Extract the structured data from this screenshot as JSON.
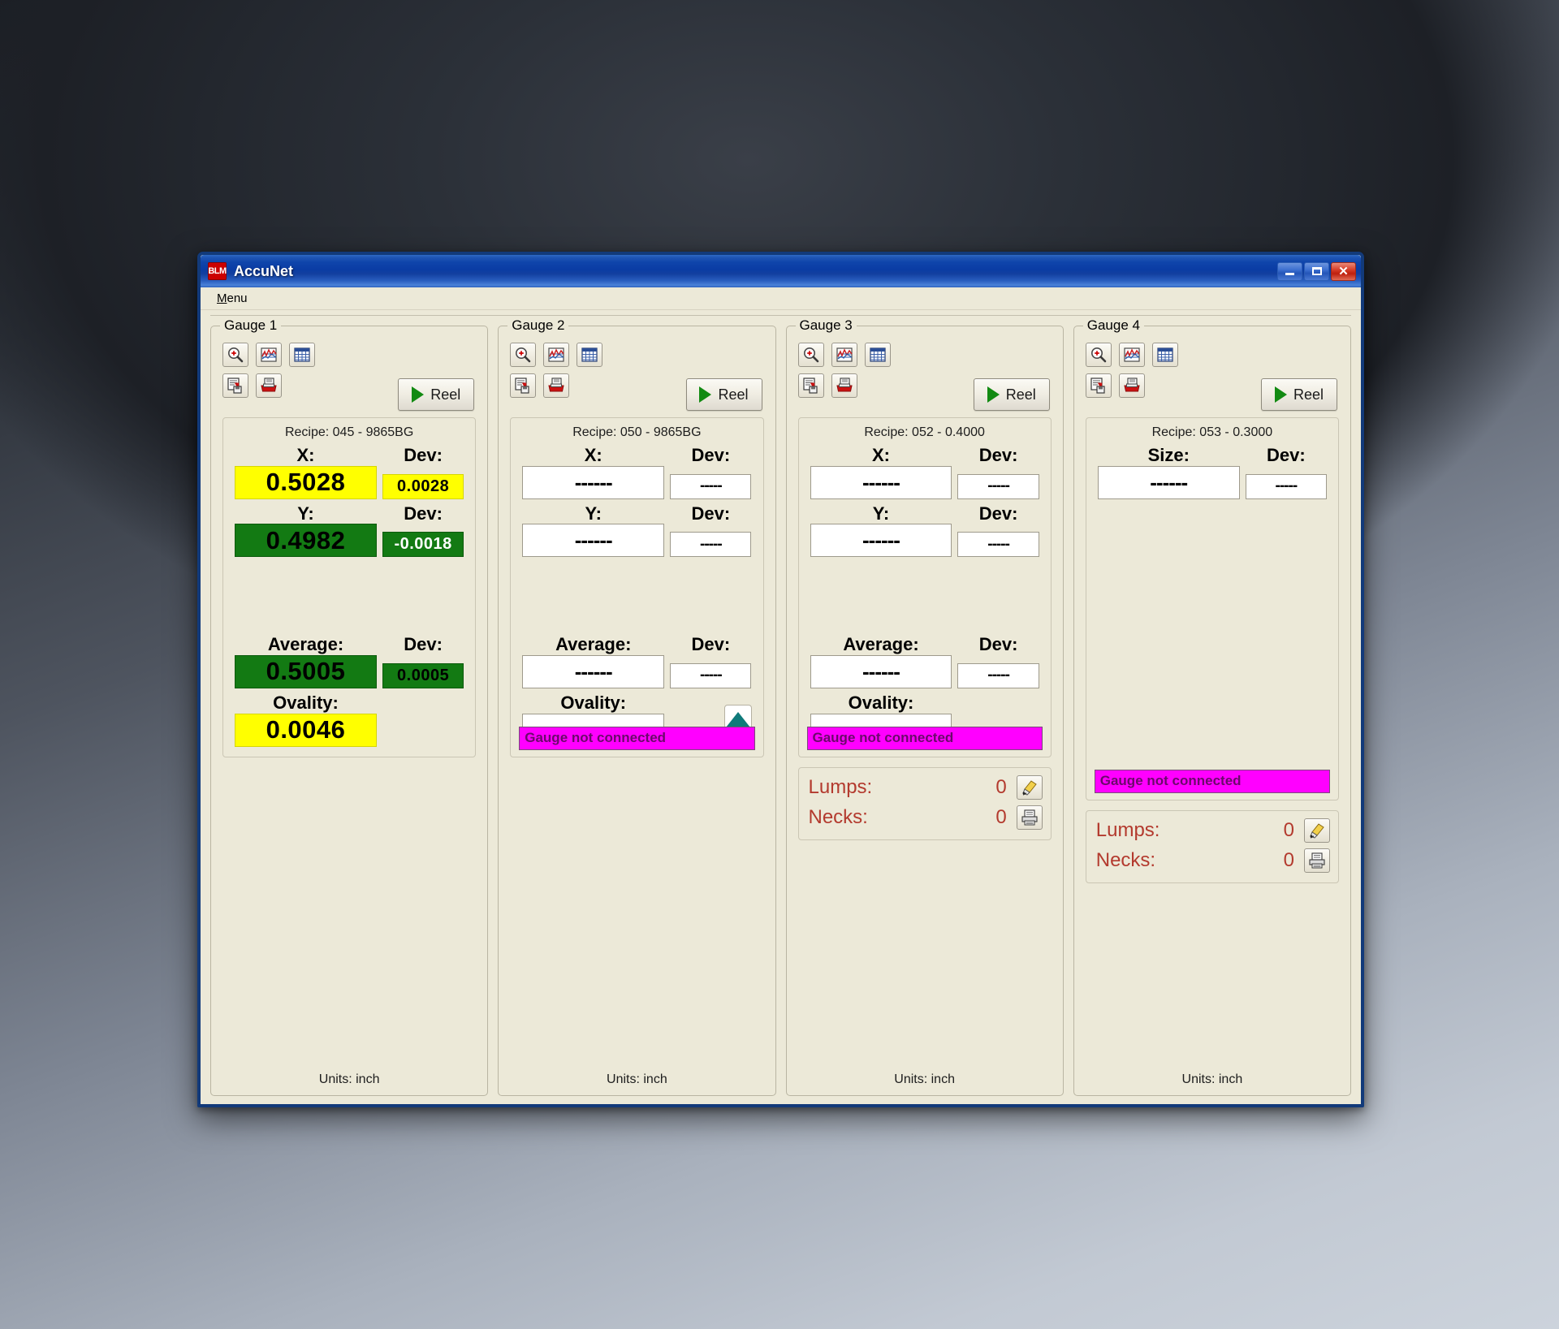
{
  "window": {
    "title": "AccuNet",
    "logo_text": "BLM",
    "minimize_label": "Minimize",
    "maximize_label": "Maximize",
    "close_label": "Close"
  },
  "menubar": {
    "menu_label": "Menu",
    "menu_accel": "M",
    "menu_rest": "enu"
  },
  "toolbar_icons": [
    "zoom-in-icon",
    "chart-icon",
    "table-icon",
    "save-report-icon",
    "print-icon"
  ],
  "common": {
    "reel_label": "Reel",
    "units_label": "Units: inch",
    "label_x": "X:",
    "label_y": "Y:",
    "label_size": "Size:",
    "label_dev": "Dev:",
    "label_average": "Average:",
    "label_ovality": "Ovality:",
    "empty_value": "------",
    "empty_dev": "-----",
    "not_connected": "Gauge not connected",
    "lumps_label": "Lumps:",
    "necks_label": "Necks:",
    "clear_icon": "eraser-icon",
    "print_icon": "print-icon"
  },
  "colors": {
    "yellow": "#ffff00",
    "green": "#137a13",
    "magenta": "#ff00ff",
    "defect_text": "#b33a2e",
    "title_blue": "#0a3ca4",
    "face": "#ece9d8"
  },
  "gauges": [
    {
      "legend": "Gauge 1",
      "recipe": "Recipe: 045 - 9865BG",
      "kind": "xy",
      "connected": true,
      "x_label": "X:",
      "x_value": "0.5028",
      "x_state": "yellow",
      "x_dev_label": "Dev:",
      "x_dev_value": "0.0028",
      "x_dev_state": "yellow",
      "y_label": "Y:",
      "y_value": "0.4982",
      "y_state": "green",
      "y_dev_label": "Dev:",
      "y_dev_value": "-0.0018",
      "y_dev_state": "green-white",
      "avg_label": "Average:",
      "avg_value": "0.5005",
      "avg_state": "green",
      "avg_dev_label": "Dev:",
      "avg_dev_value": "0.0005",
      "avg_dev_state": "green",
      "ovality_label": "Ovality:",
      "ovality_value": "0.0046",
      "ovality_state": "yellow",
      "units": "Units: inch",
      "has_defects": false,
      "status": ""
    },
    {
      "legend": "Gauge 2",
      "recipe": "Recipe: 050 - 9865BG",
      "kind": "xy",
      "connected": false,
      "x_label": "X:",
      "x_value": "------",
      "x_dev_label": "Dev:",
      "x_dev_value": "-----",
      "y_label": "Y:",
      "y_value": "------",
      "y_dev_label": "Dev:",
      "y_dev_value": "-----",
      "avg_label": "Average:",
      "avg_value": "------",
      "avg_dev_label": "Dev:",
      "avg_dev_value": "-----",
      "ovality_label": "Ovality:",
      "ovality_value": "",
      "units": "Units: inch",
      "has_defects": false,
      "has_spinner": true,
      "status": "Gauge not connected"
    },
    {
      "legend": "Gauge 3",
      "recipe": "Recipe: 052 - 0.4000",
      "kind": "xy",
      "connected": false,
      "x_label": "X:",
      "x_value": "------",
      "x_dev_label": "Dev:",
      "x_dev_value": "-----",
      "y_label": "Y:",
      "y_value": "------",
      "y_dev_label": "Dev:",
      "y_dev_value": "-----",
      "avg_label": "Average:",
      "avg_value": "------",
      "avg_dev_label": "Dev:",
      "avg_dev_value": "-----",
      "ovality_label": "Ovality:",
      "ovality_value": "",
      "units": "Units: inch",
      "has_defects": true,
      "lumps_label": "Lumps:",
      "lumps_value": "0",
      "necks_label": "Necks:",
      "necks_value": "0",
      "status": "Gauge not connected"
    },
    {
      "legend": "Gauge 4",
      "recipe": "Recipe: 053 - 0.3000",
      "kind": "size",
      "connected": false,
      "size_label": "Size:",
      "size_value": "------",
      "size_dev_label": "Dev:",
      "size_dev_value": "-----",
      "units": "Units: inch",
      "has_defects": true,
      "lumps_label": "Lumps:",
      "lumps_value": "0",
      "necks_label": "Necks:",
      "necks_value": "0",
      "status": "Gauge not connected"
    }
  ]
}
